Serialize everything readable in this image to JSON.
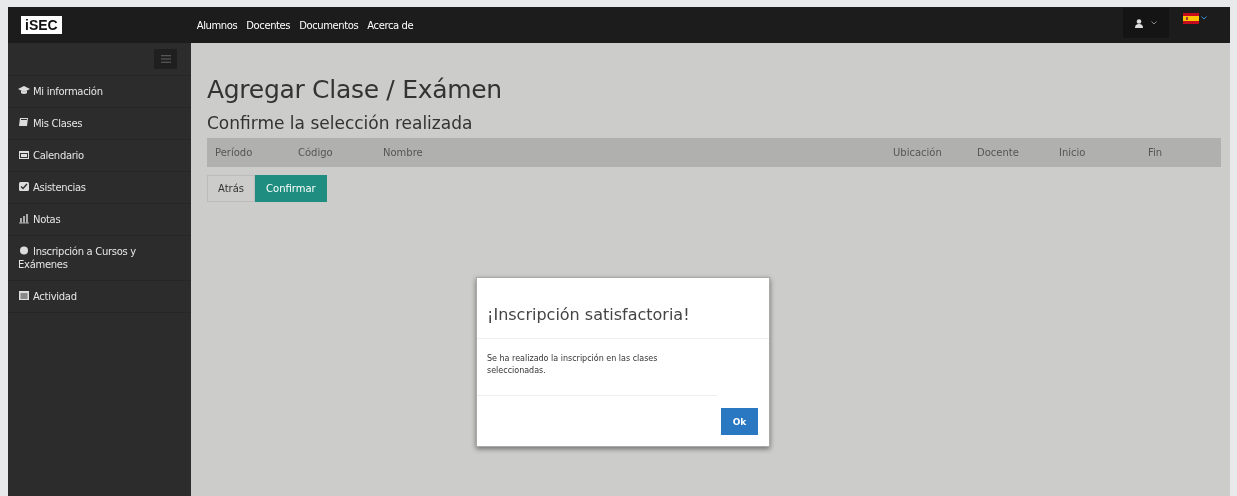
{
  "navbar": {
    "logo": "iSEC",
    "links": [
      "Alumnos",
      "Docentes",
      "Documentos",
      "Acerca de"
    ]
  },
  "sidebar": {
    "items": [
      {
        "label": "Mi información",
        "selected": false
      },
      {
        "label": "Mis Clases",
        "selected": false
      },
      {
        "label": "Calendario",
        "selected": false
      },
      {
        "label": "Asistencias",
        "selected": false
      },
      {
        "label": "Notas",
        "selected": false
      },
      {
        "label": "Inscripción a Cursos y Exámenes",
        "selected": false
      },
      {
        "label": "Actividad",
        "selected": false
      }
    ]
  },
  "page": {
    "title": "Agregar Clase / Exámen",
    "subtitle": "Confirme la selección realizada",
    "table": {
      "columns": [
        "Período",
        "Código",
        "Nombre",
        "Ubicación",
        "Docente",
        "Inicio",
        "Fin"
      ]
    },
    "buttons": [
      {
        "label": "Atrás",
        "kind": "default"
      },
      {
        "label": "Confirmar",
        "kind": "primary"
      }
    ]
  },
  "modal": {
    "title": "¡Inscripción satisfactoria!",
    "message": "Se ha realizado la inscripción en las clases seleccionadas.",
    "button": "Ok"
  }
}
